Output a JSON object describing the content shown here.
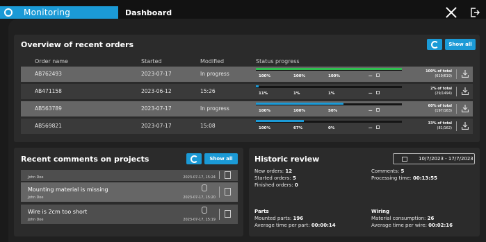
{
  "window": {
    "active_tab": "Monitoring",
    "tab2": "Dashboard"
  },
  "colors": {
    "accent": "#1b9ad6",
    "progress_green": "#2fbf4f",
    "progress_blue": "#1b9ad6"
  },
  "overview": {
    "title": "Overview of recent orders",
    "show_all": "Show all",
    "columns": [
      "Order name",
      "Started",
      "Modified",
      "Status progress"
    ],
    "rows": [
      {
        "name": "AB762493",
        "started": "2023-07-17",
        "modified": "In progress",
        "progress": 1.0,
        "color": "#2fbf4f",
        "stages": [
          "100%",
          "100%",
          "100%",
          "—"
        ],
        "pct_total": "100% of total",
        "pct_count": "(619/619)"
      },
      {
        "name": "AB471158",
        "started": "2023-06-12",
        "modified": "15:26",
        "progress": 0.02,
        "color": "#1b9ad6",
        "stages": [
          "11%",
          "1%",
          "1%",
          "—"
        ],
        "pct_total": "2% of total",
        "pct_count": "(29/1494)"
      },
      {
        "name": "AB563789",
        "started": "2023-07-17",
        "modified": "In progress",
        "progress": 0.6,
        "color": "#1b9ad6",
        "stages": [
          "100%",
          "100%",
          "50%",
          "—"
        ],
        "pct_total": "60% of total",
        "pct_count": "(197/163)"
      },
      {
        "name": "AB569821",
        "started": "2023-07-17",
        "modified": "15:08",
        "progress": 0.33,
        "color": "#1b9ad6",
        "stages": [
          "100%",
          "67%",
          "0%",
          "—"
        ],
        "pct_total": "33% of total",
        "pct_count": "(81/162)"
      }
    ]
  },
  "comments": {
    "title": "Recent comments on projects",
    "show_all": "Show all",
    "items": [
      {
        "text": "",
        "author": "John Doe",
        "date": "2023-07-17, 15:24"
      },
      {
        "text": "Mounting material is missing",
        "author": "John Doe",
        "date": "2023-07-17, 15:20"
      },
      {
        "text": "Wire is 2cm too short",
        "author": "John Doe",
        "date": "2023-07-17, 15:19"
      }
    ]
  },
  "historic": {
    "title": "Historic review",
    "date_range": "10/7/2023 - 17/7/2023",
    "new_orders_label": "New orders:",
    "new_orders": "12",
    "started_orders_label": "Started orders:",
    "started_orders": "5",
    "finished_orders_label": "Finished orders:",
    "finished_orders": "0",
    "comments_label": "Comments:",
    "comments": "5",
    "processing_label": "Processing time:",
    "processing": "00:13:55",
    "parts_heading": "Parts",
    "mounted_label": "Mounted parts:",
    "mounted": "196",
    "avg_part_label": "Average time per part:",
    "avg_part": "00:00:14",
    "wiring_heading": "Wiring",
    "material_label": "Material consumption:",
    "material": "26",
    "avg_wire_label": "Average time per wire:",
    "avg_wire": "00:02:16"
  }
}
